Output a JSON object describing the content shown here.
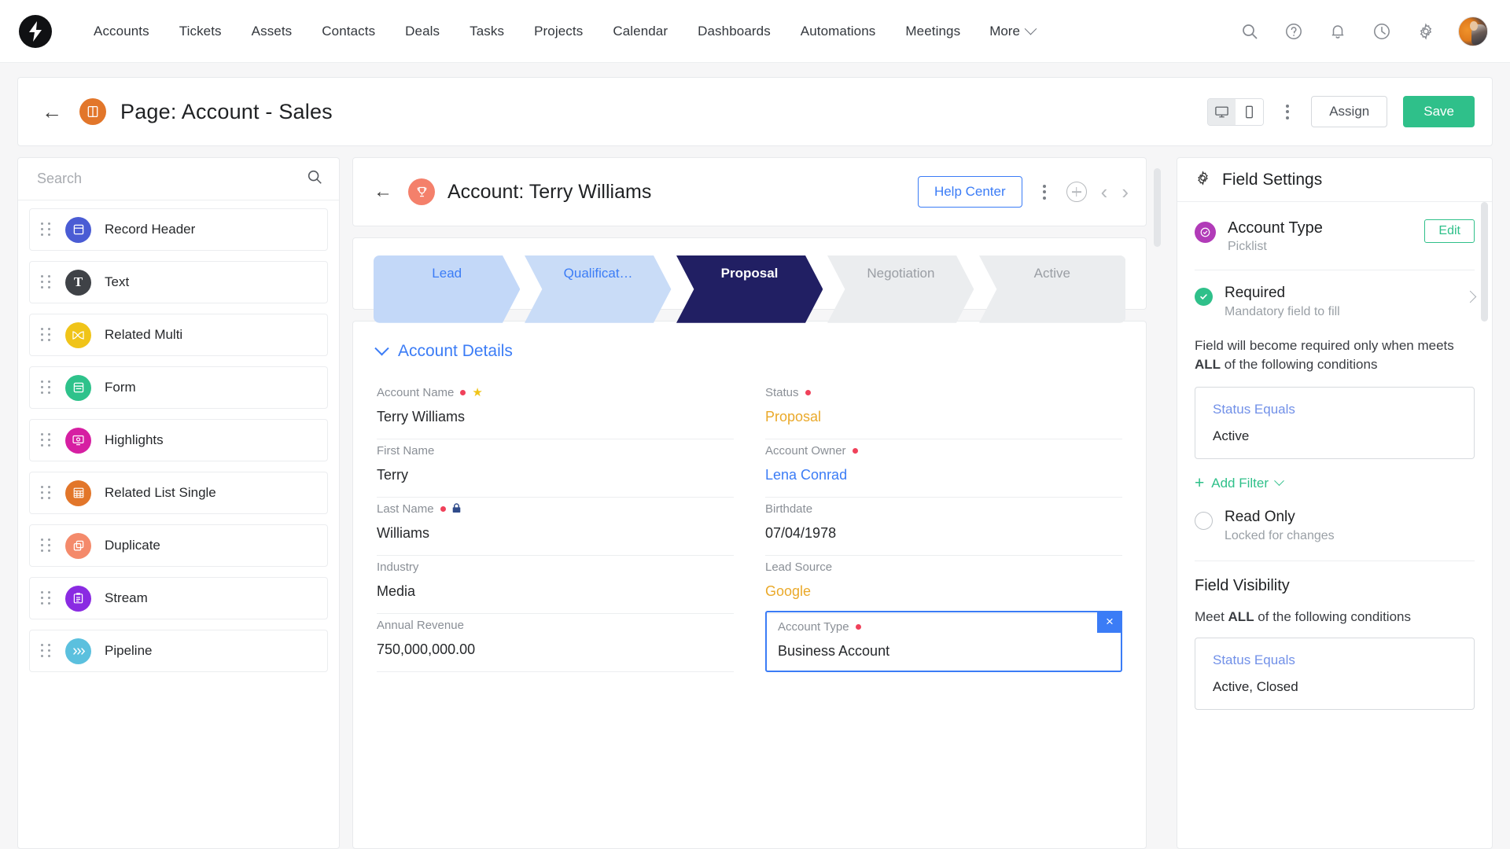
{
  "topnav": {
    "logo_name": "brand-logo",
    "links": [
      "Accounts",
      "Tickets",
      "Assets",
      "Contacts",
      "Deals",
      "Tasks",
      "Projects",
      "Calendar",
      "Dashboards",
      "Automations",
      "Meetings"
    ],
    "more_label": "More",
    "icons": [
      "search-icon",
      "help-icon",
      "notifications-icon",
      "recent-activity-icon",
      "settings-icon"
    ]
  },
  "page_bar": {
    "back_label": "←",
    "title": "Page: Account - Sales",
    "device_desktop": "desktop-view-icon",
    "device_mobile": "mobile-view-icon",
    "assign_label": "Assign",
    "save_label": "Save"
  },
  "palette": {
    "search_placeholder": "Search",
    "search_value": "",
    "items": [
      {
        "label": "Record Header",
        "color": "#4a5cd4",
        "glyph": "▤"
      },
      {
        "label": "Text",
        "color": "#3f4247",
        "glyph": "T"
      },
      {
        "label": "Related Multi",
        "color": "#f0c419",
        "glyph": "⧉"
      },
      {
        "label": "Form",
        "color": "#2ec28b",
        "glyph": "▤"
      },
      {
        "label": "Highlights",
        "color": "#d61fa2",
        "glyph": "◎"
      },
      {
        "label": "Related List Single",
        "color": "#e2762a",
        "glyph": "▦"
      },
      {
        "label": "Duplicate",
        "color": "#f48a6b",
        "glyph": "❐"
      },
      {
        "label": "Stream",
        "color": "#8a2be2",
        "glyph": "ὌB"
      },
      {
        "label": "Pipeline",
        "color": "#5bc0de",
        "glyph": "⋙"
      }
    ]
  },
  "record": {
    "back_label": "←",
    "title": "Account: Terry Williams",
    "help_label": "Help Center",
    "prev_label": "‹",
    "next_label": "›"
  },
  "pipeline": {
    "stages": [
      {
        "label": "Lead",
        "state": "done"
      },
      {
        "label": "Qualificat…",
        "state": "done"
      },
      {
        "label": "Proposal",
        "state": "current"
      },
      {
        "label": "Negotiation",
        "state": "next"
      },
      {
        "label": "Active",
        "state": "next"
      }
    ],
    "colors": {
      "done1": "#c3d8f8",
      "done2": "#c9dcf7",
      "current": "#211f63",
      "next": "#ebedef"
    }
  },
  "details": {
    "section_title": "Account Details",
    "left_fields": [
      {
        "label": "Account Name",
        "value": "Terry Williams",
        "required": true,
        "starred": true,
        "locked": false,
        "style": "plain"
      },
      {
        "label": "First Name",
        "value": "Terry",
        "required": false,
        "starred": false,
        "locked": false,
        "style": "plain"
      },
      {
        "label": "Last Name",
        "value": "Williams",
        "required": true,
        "starred": false,
        "locked": true,
        "style": "plain"
      },
      {
        "label": "Industry",
        "value": "Media",
        "required": false,
        "starred": false,
        "locked": false,
        "style": "plain"
      },
      {
        "label": "Annual Revenue",
        "value": "750,000,000.00",
        "required": false,
        "starred": false,
        "locked": false,
        "style": "plain"
      }
    ],
    "right_fields": [
      {
        "label": "Status",
        "value": "Proposal",
        "required": true,
        "starred": false,
        "locked": false,
        "style": "pick"
      },
      {
        "label": "Account Owner",
        "value": "Lena Conrad",
        "required": true,
        "starred": false,
        "locked": false,
        "style": "link"
      },
      {
        "label": "Birthdate",
        "value": "07/04/1978",
        "required": false,
        "starred": false,
        "locked": false,
        "style": "plain"
      },
      {
        "label": "Lead Source",
        "value": "Google",
        "required": false,
        "starred": false,
        "locked": false,
        "style": "pick"
      },
      {
        "label": "Account Type",
        "value": "Business Account",
        "required": true,
        "starred": false,
        "locked": false,
        "style": "plain",
        "selected": true,
        "close_label": "×"
      }
    ]
  },
  "field_settings": {
    "panel_title": "Field Settings",
    "field_name": "Account Type",
    "field_type": "Picklist",
    "edit_label": "Edit",
    "required": {
      "title": "Required",
      "subtitle": "Mandatory field to fill",
      "enabled": true,
      "description_1": "Field will become required only when meets ",
      "description_bold": "ALL",
      "description_2": " of the following conditions",
      "condition": {
        "title": "Status Equals",
        "value": "Active"
      },
      "add_filter_label": "Add Filter"
    },
    "read_only": {
      "title": "Read Only",
      "subtitle": "Locked for changes",
      "enabled": false
    },
    "visibility": {
      "title": "Field Visibility",
      "meet_1": "Meet ",
      "meet_bold": "ALL",
      "meet_2": " of the following conditions",
      "condition": {
        "title": "Status Equals",
        "value": "Active, Closed"
      }
    }
  },
  "colors": {
    "accent_blue": "#3b7cf6",
    "accent_green": "#2fc08a",
    "required_red": "#f0415a",
    "picklist_amber": "#eaa92a",
    "brand_orange": "#e2762a"
  }
}
